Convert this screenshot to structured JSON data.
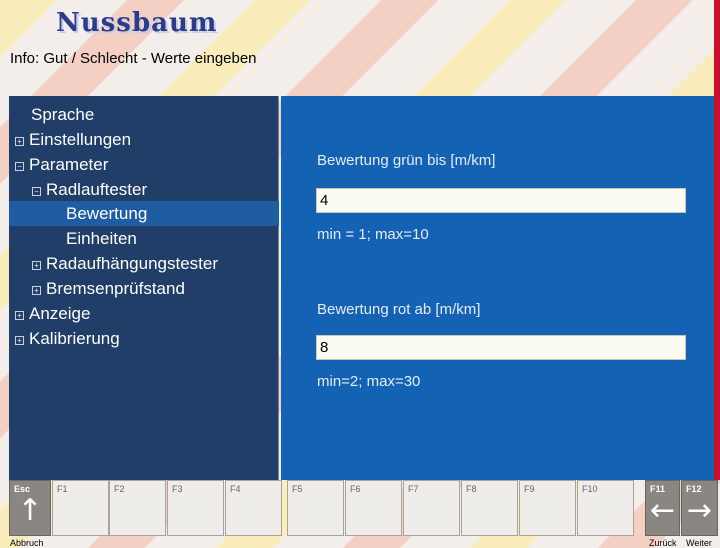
{
  "app": {
    "logo": "Nussbaum",
    "info": "Info: Gut / Schlecht - Werte eingeben"
  },
  "colors": {
    "accent": "#1462b4",
    "nav_bg": "#203e68",
    "selected": "#1f5da3",
    "brand_red": "#c8102e"
  },
  "nav": {
    "items": [
      {
        "label": "Sprache",
        "expander": ""
      },
      {
        "label": "Einstellungen",
        "expander": "+"
      },
      {
        "label": "Parameter",
        "expander": "-"
      },
      {
        "label": "Radlauftester",
        "expander": "-"
      },
      {
        "label": "Bewertung",
        "expander": ""
      },
      {
        "label": "Einheiten",
        "expander": ""
      },
      {
        "label": "Radaufhängungstester",
        "expander": "+"
      },
      {
        "label": "Bremsenprüfstand",
        "expander": "+"
      },
      {
        "label": "Anzeige",
        "expander": "+"
      },
      {
        "label": "Kalibrierung",
        "expander": "+"
      }
    ],
    "selected": "Bewertung"
  },
  "form": {
    "green_label": "Bewertung grün bis [m/km]",
    "green_value": "4",
    "green_hint": "min = 1; max=10",
    "red_label": "Bewertung rot ab [m/km]",
    "red_value": "8",
    "red_hint": "min=2; max=30"
  },
  "fkeys": {
    "esc": {
      "key": "Esc",
      "icon": "arrow-up-icon",
      "caption": "Abbruch"
    },
    "f1": "F1",
    "f2": "F2",
    "f3": "F3",
    "f4": "F4",
    "f5": "F5",
    "f6": "F6",
    "f7": "F7",
    "f8": "F8",
    "f9": "F9",
    "f10": "F10",
    "f11": {
      "key": "F11",
      "icon": "arrow-left-icon",
      "caption": "Zurück"
    },
    "f12": {
      "key": "F12",
      "icon": "arrow-right-icon",
      "caption": "Weiter"
    }
  }
}
